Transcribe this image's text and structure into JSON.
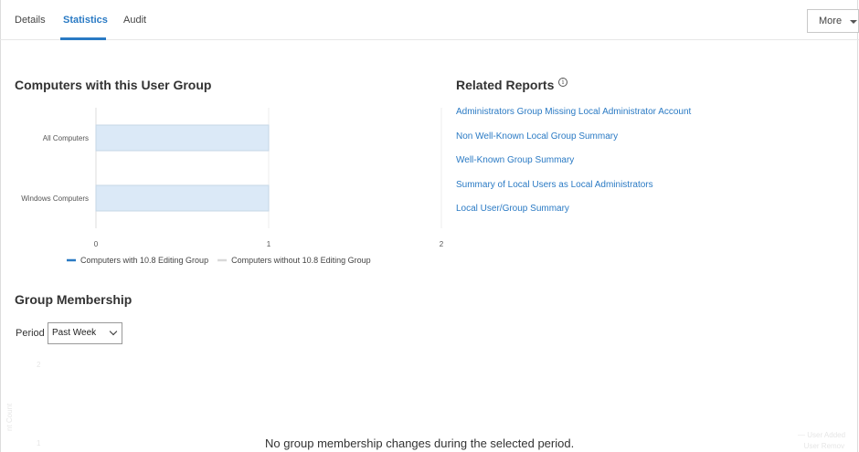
{
  "tabs": [
    {
      "label": "Details",
      "active": false
    },
    {
      "label": "Statistics",
      "active": true
    },
    {
      "label": "Audit",
      "active": false
    }
  ],
  "more_button": {
    "label": "More",
    "icon": "caret-down-icon"
  },
  "computers_section": {
    "title": "Computers with this User Group"
  },
  "chart_data": {
    "type": "bar",
    "orientation": "horizontal",
    "stacked": true,
    "categories": [
      "All Computers",
      "Windows Computers"
    ],
    "series": [
      {
        "name": "Computers with 10.8 Editing Group",
        "values": [
          0,
          0
        ],
        "color": "#2a7ac4"
      },
      {
        "name": "Computers without 10.8 Editing Group",
        "values": [
          1,
          1
        ],
        "color": "#dbe9f7"
      }
    ],
    "xlim": [
      0,
      2
    ],
    "x_ticks": [
      "0",
      "1",
      "2"
    ],
    "grid": true,
    "legend_position": "bottom"
  },
  "related_reports": {
    "title": "Related Reports",
    "info_icon": "info-icon",
    "links": [
      "Administrators Group Missing Local Administrator Account",
      "Non Well-Known Local Group Summary",
      "Well-Known Group Summary",
      "Summary of Local Users as Local Administrators",
      "Local User/Group Summary"
    ]
  },
  "group_membership": {
    "title": "Group Membership",
    "period_label": "Period",
    "period_value": "Past Week",
    "empty_message": "No group membership changes during the selected period.",
    "faint_chart": {
      "y_ticks": [
        "2",
        "1"
      ],
      "y_label": "nt Count",
      "legend": [
        "User Added",
        "User Remov"
      ]
    }
  }
}
